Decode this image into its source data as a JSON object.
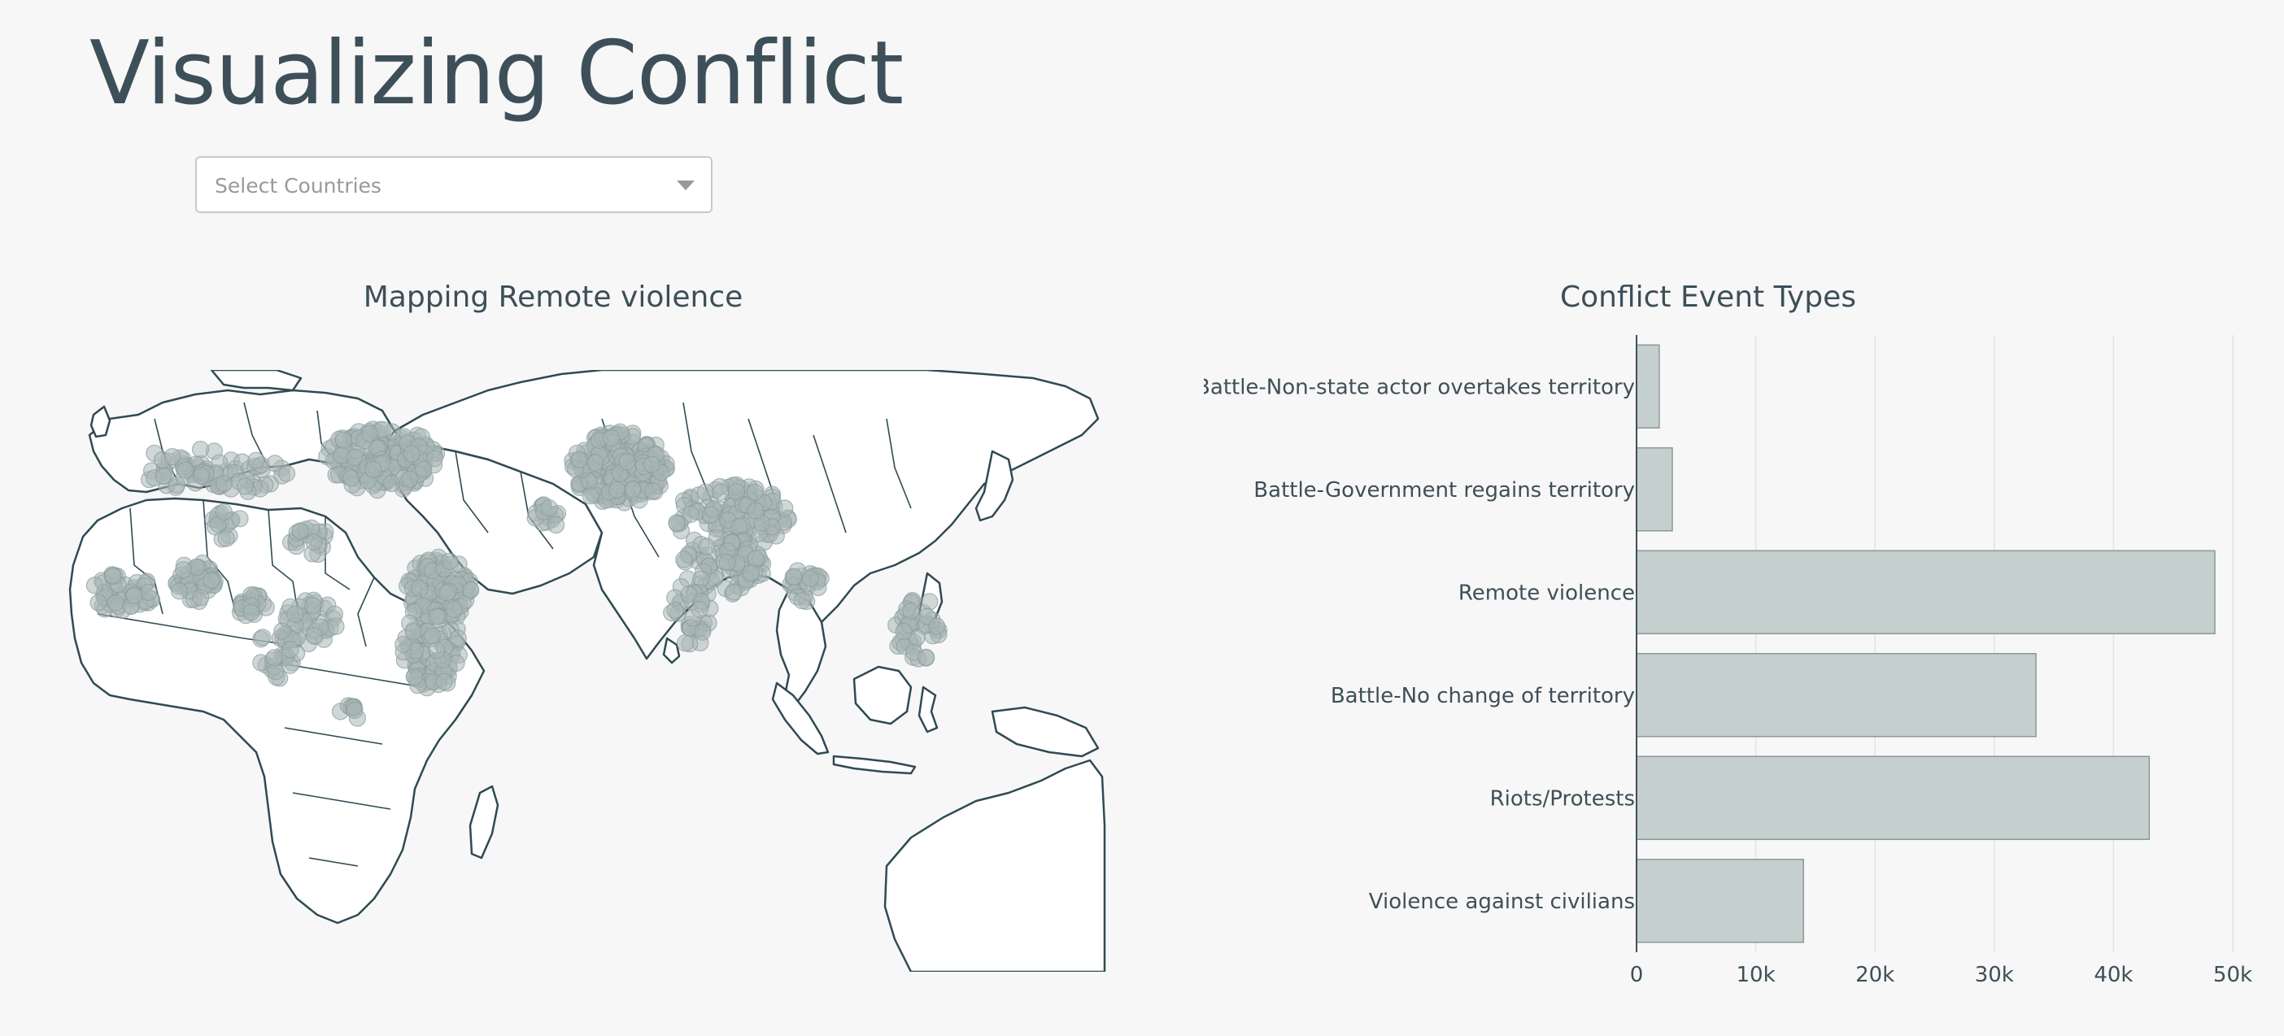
{
  "header": {
    "title": "Visualizing Conflict"
  },
  "country_select": {
    "placeholder": "Select Countries"
  },
  "map": {
    "title": "Mapping Remote violence",
    "land_color": "#ffffff",
    "border_color": "#2f4a53",
    "marker_color": "#a9b7b7",
    "marker_edge": "#8a9b9b"
  },
  "bar_chart": {
    "title": "Conflict Event Types"
  },
  "chart_data": {
    "type": "bar",
    "orientation": "horizontal",
    "title": "Conflict Event Types",
    "categories": [
      "Battle-Non-state actor overtakes territory",
      "Battle-Government regains territory",
      "Remote violence",
      "Battle-No change of territory",
      "Riots/Protests",
      "Violence against civilians"
    ],
    "values": [
      1900,
      3000,
      48500,
      33500,
      43000,
      14000
    ],
    "xlim": [
      0,
      50000
    ],
    "xticks": [
      0,
      10000,
      20000,
      30000,
      40000,
      50000
    ],
    "xtick_labels": [
      "0",
      "10k",
      "20k",
      "30k",
      "40k",
      "50k"
    ],
    "grid": "vertical",
    "bar_color": "#c5cfcd",
    "bar_edge": "#8a9a99"
  }
}
